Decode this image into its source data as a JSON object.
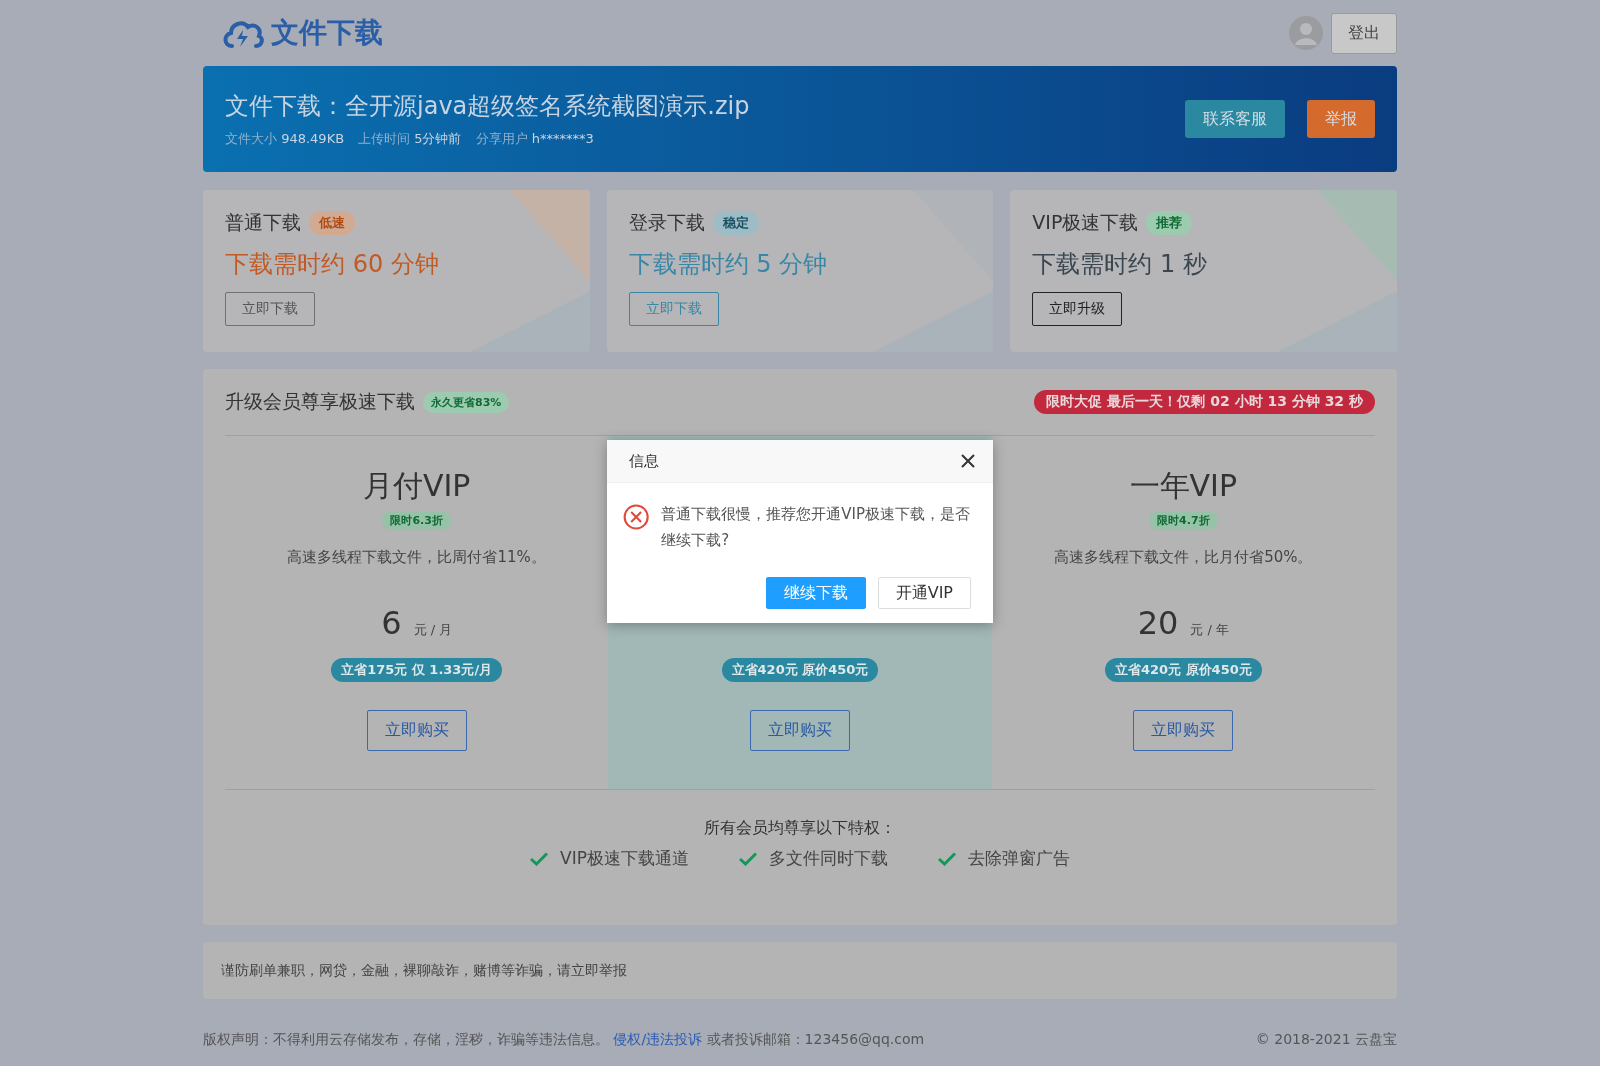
{
  "header": {
    "logo_text": "文件下载",
    "logout": "登出"
  },
  "banner": {
    "title": "文件下载：全开源java超级签名系统截图演示.zip",
    "meta": [
      {
        "label": "文件大小",
        "value": "948.49KB"
      },
      {
        "label": "上传时间",
        "value": "5分钟前"
      },
      {
        "label": "分享用户",
        "value": "h*******3"
      }
    ],
    "buttons": [
      {
        "label": "联系客服",
        "kind": "contact"
      },
      {
        "label": "举报",
        "kind": "report"
      }
    ]
  },
  "download_options": [
    {
      "title": "普通下载",
      "tag": "低速",
      "kind": "slow",
      "time": "下载需时约 60 分钟",
      "button": "立即下载"
    },
    {
      "title": "登录下载",
      "tag": "稳定",
      "kind": "stable",
      "time": "下载需时约 5 分钟",
      "button": "立即下载"
    },
    {
      "title": "VIP极速下载",
      "tag": "推荐",
      "kind": "recommended",
      "time": "下载需时约 1 秒",
      "button": "立即升级"
    }
  ],
  "upgrade": {
    "title": "升级会员尊享极速下载",
    "tag": "永久更省83%",
    "countdown": "限时大促 最后一天！仅剩 02 小时 13 分钟 32 秒",
    "plans": [
      {
        "title": "月付VIP",
        "badge": "限时6.3折",
        "desc": "高速多线程下载文件，比周付省11%。",
        "price": "6",
        "unit": "元 / 月",
        "saving": "立省175元 仅 1.33元/月",
        "button": "立即购买",
        "selected": false
      },
      {
        "saving": "立省420元 原价450元",
        "button": "立即购买",
        "selected": true
      },
      {
        "title": "一年VIP",
        "badge": "限时4.7折",
        "desc": "高速多线程下载文件，比月付省50%。",
        "price": "20",
        "unit": "元 / 年",
        "saving": "立省420元 原价450元",
        "button": "立即购买",
        "selected": false
      }
    ],
    "perks_heading": "所有会员均尊享以下特权：",
    "perks": [
      "VIP极速下载通道",
      "多文件同时下载",
      "去除弹窗广告"
    ]
  },
  "notice": "谨防刷单兼职，网贷，金融，裸聊敲诈，赌博等诈骗，请立即举报",
  "footer": {
    "text": "版权声明：不得利用云存储发布，存储，淫秽，诈骗等违法信息。",
    "link": "侵权/违法投诉",
    "after": "或者投诉邮箱：123456@qq.com",
    "copyright": "© 2018-2021 云盘宝"
  },
  "dialog": {
    "title": "信息",
    "message": "普通下载很慢，推荐您开通VIP极速下载，是否继续下载?",
    "buttons": [
      {
        "label": "继续下载",
        "kind": "primary"
      },
      {
        "label": "开通VIP",
        "kind": "default"
      }
    ]
  }
}
